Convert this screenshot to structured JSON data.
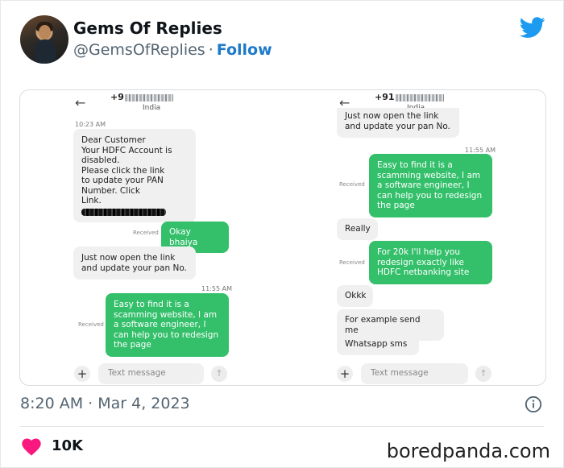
{
  "tweet": {
    "user_name": "Gems Of Replies",
    "handle": "@GemsOfReplies",
    "separator": "·",
    "follow_label": "Follow",
    "datetime": "8:20 AM · Mar 4, 2023",
    "likes": "10K",
    "watermark": "boredpanda.com"
  },
  "icons": {
    "brand": "twitter-bird-icon",
    "info": "info-icon",
    "like": "heart-icon"
  },
  "colors": {
    "follow": "#1d7ac9",
    "twitter": "#1d9bf0",
    "heart": "#f91880",
    "sent_bubble": "#34c06b",
    "received_bubble": "#f0f0f0"
  },
  "left_chat": {
    "phone_prefix": "+9",
    "country": "India",
    "timestamp1": "10:23 AM",
    "msg1_lines": [
      "Dear Customer",
      "Your HDFC Account is",
      "disabled.",
      "Please click the link",
      "to update your PAN",
      "Number. Click",
      "Link."
    ],
    "received_label": "Received",
    "reply1": "Okay bhaiya",
    "msg2": "Just now open the link and update your pan No.",
    "timestamp2": "11:55 AM",
    "reply2": "Easy to find it is a scamming website, I am a software engineer, I can help you to redesign the page",
    "received_label2": "Received",
    "composer_placeholder": "Text message",
    "plus": "+",
    "send": "↑"
  },
  "right_chat": {
    "phone_prefix": "+91",
    "country": "India",
    "msg_top": "Just now open the link and update your pan No.",
    "timestamp": "11:55 AM",
    "reply1": "Easy to find it is a scamming website, I am a software engineer, I can help you to redesign the page",
    "received_label1": "Received",
    "msg_really": "Really",
    "reply2": "For 20k I'll help you redesign exactly like HDFC netbanking site",
    "received_label2": "Received",
    "msg_okkk": "Okkk",
    "msg_example": "For example send me",
    "msg_whatsapp": "Whatsapp sms",
    "composer_placeholder": "Text message",
    "plus": "+",
    "send": "↑"
  }
}
